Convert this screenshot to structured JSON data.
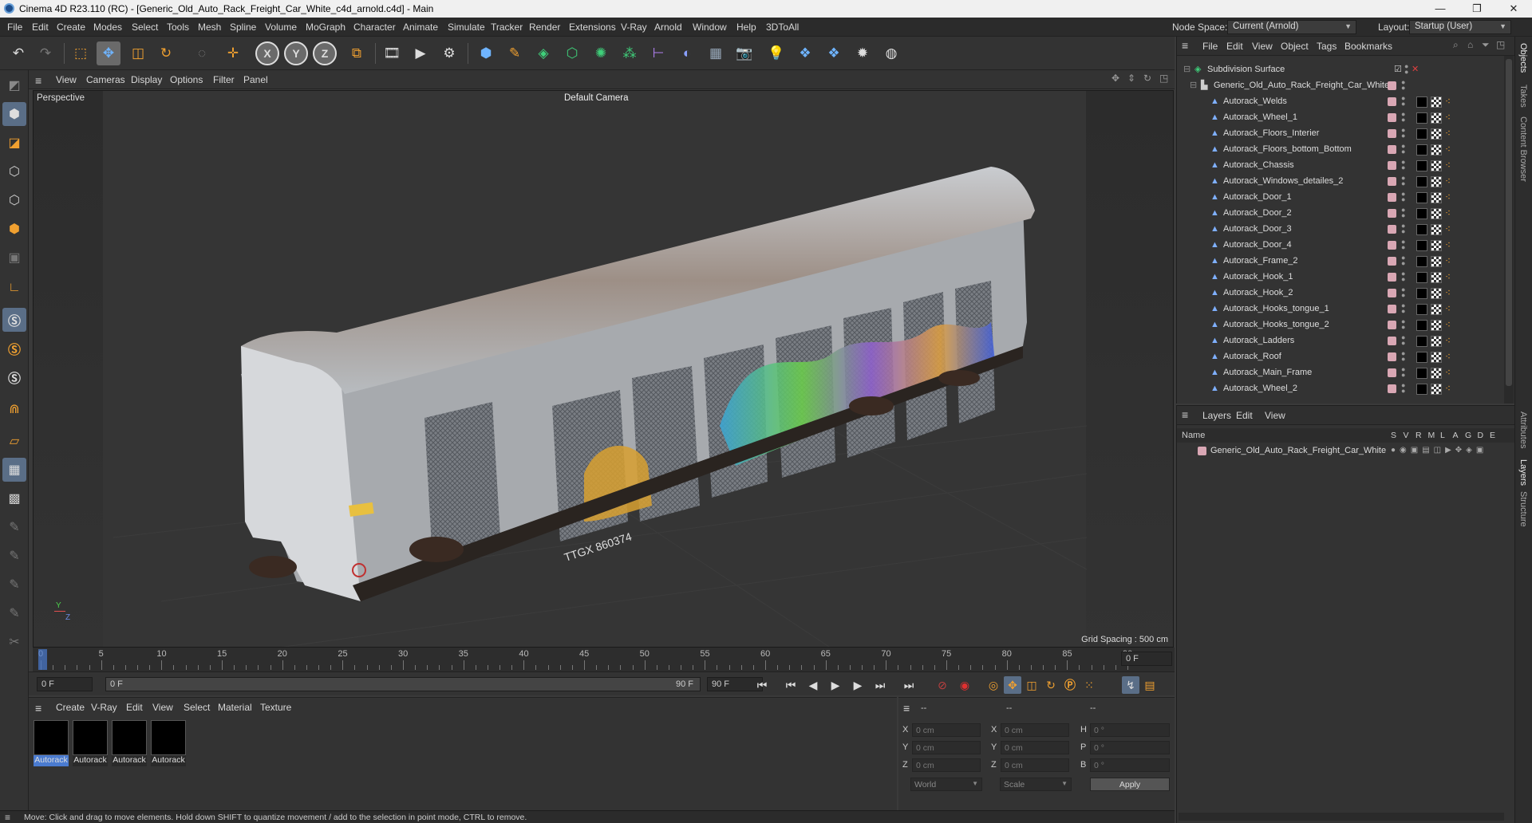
{
  "window": {
    "title": "Cinema 4D R23.110 (RC) - [Generic_Old_Auto_Rack_Freight_Car_White_c4d_arnold.c4d] - Main",
    "controls": [
      "—",
      "❐",
      "✕"
    ]
  },
  "menubar": {
    "items": [
      "File",
      "Edit",
      "Create",
      "Modes",
      "Select",
      "Tools",
      "Mesh",
      "Spline",
      "Volume",
      "MoGraph",
      "Character",
      "Animate",
      "Simulate",
      "Tracker",
      "Render",
      "Extensions",
      "V-Ray",
      "Arnold",
      "Window",
      "Help",
      "3DToAll"
    ],
    "node_space_label": "Node Space:",
    "node_space_value": "Current (Arnold)",
    "layout_label": "Layout:",
    "layout_value": "Startup (User)"
  },
  "toolbar": {
    "icons": [
      "undo-icon",
      "redo-icon",
      "live-select-icon",
      "move-icon",
      "scale-icon",
      "rotate-icon",
      "last-tool-icon",
      "x-axis-icon",
      "y-axis-icon",
      "z-axis-icon",
      "coordinate-system-icon",
      "render-view-icon",
      "render-icon",
      "render-settings-icon",
      "cube-icon",
      "pen-icon",
      "subdivision-icon",
      "extrude-icon",
      "cloner-icon",
      "mograph-icon",
      "symmetry-icon",
      "deformer-icon",
      "floor-icon",
      "camera-icon",
      "light-icon",
      "python-icon",
      "python2-icon",
      "gear-icon",
      "globe-icon"
    ],
    "axis_labels": [
      "X",
      "Y",
      "Z"
    ]
  },
  "viewport": {
    "menu": [
      "View",
      "Cameras",
      "Display",
      "Options",
      "Filter",
      "Panel"
    ],
    "label": "Perspective",
    "camera": "Default Camera",
    "grid_spacing": "Grid Spacing : 500 cm",
    "graffiti_text": "TTGX 860374"
  },
  "timeline": {
    "ticks": [
      "0",
      "5",
      "10",
      "15",
      "20",
      "25",
      "30",
      "35",
      "40",
      "45",
      "50",
      "55",
      "60",
      "65",
      "70",
      "75",
      "80",
      "85",
      "90"
    ],
    "current_frame_right": "0 F",
    "start_field": "0 F",
    "range_start": "0 F",
    "range_end": "90 F",
    "end_field": "90 F"
  },
  "material_manager": {
    "menu": [
      "Create",
      "V-Ray",
      "Edit",
      "View",
      "Select",
      "Material",
      "Texture"
    ],
    "materials": [
      "Autorack",
      "Autorack",
      "Autorack",
      "Autorack"
    ]
  },
  "coordinates": {
    "headers": [
      "--",
      "--",
      "--"
    ],
    "rows": [
      {
        "a": "X",
        "av": "0 cm",
        "b": "X",
        "bv": "0 cm",
        "c": "H",
        "cv": "0 °"
      },
      {
        "a": "Y",
        "av": "0 cm",
        "b": "Y",
        "bv": "0 cm",
        "c": "P",
        "cv": "0 °"
      },
      {
        "a": "Z",
        "av": "0 cm",
        "b": "Z",
        "bv": "0 cm",
        "c": "B",
        "cv": "0 °"
      }
    ],
    "mode": "World",
    "scale": "Scale",
    "apply": "Apply"
  },
  "status": "Move: Click and drag to move elements. Hold down SHIFT to quantize movement / add to the selection in point mode, CTRL to remove.",
  "objects": {
    "menu": [
      "File",
      "Edit",
      "View",
      "Object",
      "Tags",
      "Bookmarks"
    ],
    "root": "Subdivision Surface",
    "group": "Generic_Old_Auto_Rack_Freight_Car_White",
    "children": [
      "Autorack_Welds",
      "Autorack_Wheel_1",
      "Autorack_Floors_Interier",
      "Autorack_Floors_bottom_Bottom",
      "Autorack_Chassis",
      "Autorack_Windows_detailes_2",
      "Autorack_Door_1",
      "Autorack_Door_2",
      "Autorack_Door_3",
      "Autorack_Door_4",
      "Autorack_Frame_2",
      "Autorack_Hook_1",
      "Autorack_Hook_2",
      "Autorack_Hooks_tongue_1",
      "Autorack_Hooks_tongue_2",
      "Autorack_Ladders",
      "Autorack_Roof",
      "Autorack_Main_Frame",
      "Autorack_Wheel_2"
    ]
  },
  "layers": {
    "menu": [
      "Layers",
      "Edit",
      "View"
    ],
    "name_header": "Name",
    "flag_headers": [
      "S",
      "V",
      "R",
      "M",
      "L",
      "A",
      "G",
      "D",
      "E"
    ],
    "items": [
      "Generic_Old_Auto_Rack_Freight_Car_White"
    ]
  },
  "right_tabs": [
    "Objects",
    "Takes",
    "Content Browser",
    "Attributes",
    "Layers",
    "Structure"
  ],
  "colors": {
    "accent": "#5a6e87",
    "layer_color": "#d9a7b4",
    "selection": "#4a7bd0"
  }
}
